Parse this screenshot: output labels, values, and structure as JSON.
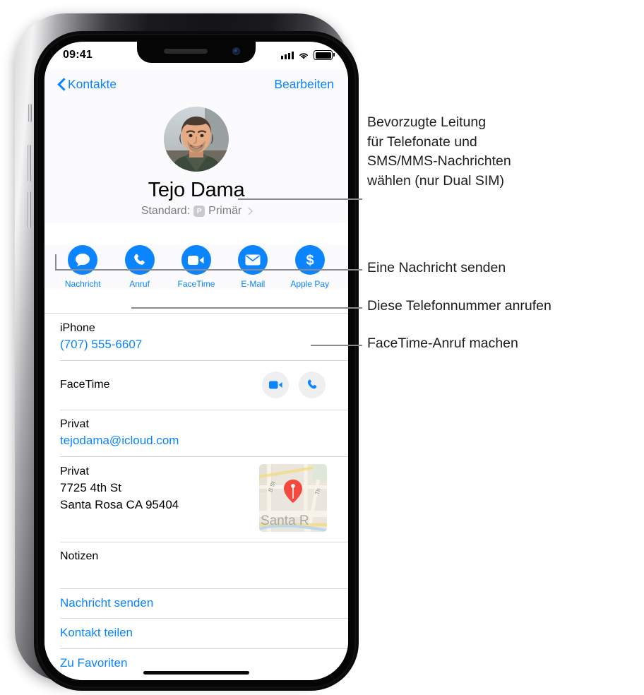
{
  "status_bar": {
    "time": "09:41",
    "signal_icon": "cellular-signal-icon",
    "wifi_icon": "wifi-icon",
    "battery_icon": "battery-icon"
  },
  "nav": {
    "back_label": "Kontakte",
    "back_icon": "chevron-left-icon",
    "edit_label": "Bearbeiten"
  },
  "contact": {
    "avatar_alt": "contact-photo",
    "name": "Tejo Dama",
    "default_prefix": "Standard:",
    "sim_badge": "P",
    "default_line": "Primär",
    "chevron_icon": "chevron-right-icon"
  },
  "actions": [
    {
      "label": "Nachricht",
      "icon": "message-bubble-icon"
    },
    {
      "label": "Anruf",
      "icon": "phone-handset-icon"
    },
    {
      "label": "FaceTime",
      "icon": "video-camera-icon"
    },
    {
      "label": "E-Mail",
      "icon": "envelope-icon"
    },
    {
      "label": "Apple Pay",
      "icon": "dollar-sign-icon"
    }
  ],
  "details": {
    "phone": {
      "label": "iPhone",
      "value": "(707) 555-6607"
    },
    "facetime": {
      "label": "FaceTime",
      "video_icon": "video-camera-icon",
      "audio_icon": "phone-handset-icon"
    },
    "email": {
      "label": "Privat",
      "value": "tejodama@icloud.com"
    },
    "address": {
      "label": "Privat",
      "street": "7725 4th St",
      "city": "Santa Rosa CA 95404",
      "map_icon": "map-pin-icon",
      "map_labels": {
        "street_left": "B St",
        "street_right": "Th",
        "city": "Santa R"
      }
    },
    "notes": {
      "label": "Notizen"
    }
  },
  "links": [
    {
      "label": "Nachricht senden"
    },
    {
      "label": "Kontakt teilen"
    },
    {
      "label": "Zu Favoriten"
    }
  ],
  "callouts": [
    {
      "text": "Bevorzugte Leitung\nfür Telefonate und\nSMS/MMS-Nachrichten\nwählen (nur Dual SIM)"
    },
    {
      "text": "Eine Nachricht senden"
    },
    {
      "text": "Diese Telefonnummer anrufen"
    },
    {
      "text": "FaceTime-Anruf machen"
    }
  ],
  "colors": {
    "accent_blue": "#0a84ff",
    "separator": "#d6d6da",
    "header_bg": "#fbfbfd",
    "leader_line": "#8a8a8e",
    "map_pin": "#f4493f"
  }
}
